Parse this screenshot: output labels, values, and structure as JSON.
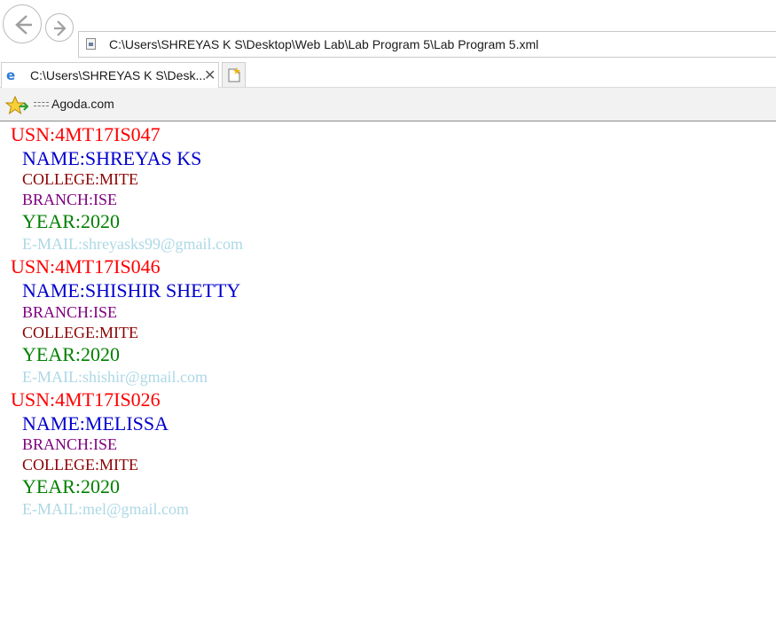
{
  "browser": {
    "address": "C:\\Users\\SHREYAS K S\\Desktop\\Web Lab\\Lab Program 5\\Lab Program 5.xml",
    "tab_title": "C:\\Users\\SHREYAS K S\\Desk...",
    "tab_close": "✕",
    "favorites": [
      {
        "label": "Agoda.com"
      }
    ]
  },
  "students": [
    {
      "usn": "USN:4MT17IS047",
      "name": "NAME:SHREYAS KS",
      "college": "COLLEGE:MITE",
      "branch": "BRANCH:ISE",
      "year": "YEAR:2020",
      "email": "E-MAIL:shreyasks99@gmail.com"
    },
    {
      "usn": "USN:4MT17IS046",
      "name": "NAME:SHISHIR SHETTY",
      "branch": "BRANCH:ISE",
      "college": "COLLEGE:MITE",
      "year": "YEAR:2020",
      "email": "E-MAIL:shishir@gmail.com"
    },
    {
      "usn": "USN:4MT17IS026",
      "name": "NAME:MELISSA",
      "branch": "BRANCH:ISE",
      "college": "COLLEGE:MITE",
      "year": "YEAR:2020",
      "email": "E-MAIL:mel@gmail.com"
    }
  ],
  "colors": {
    "usn": "#ff0000",
    "name": "#0000cd",
    "college": "#8b0000",
    "branch": "#800080",
    "year": "#008000",
    "email": "#add8e6"
  }
}
